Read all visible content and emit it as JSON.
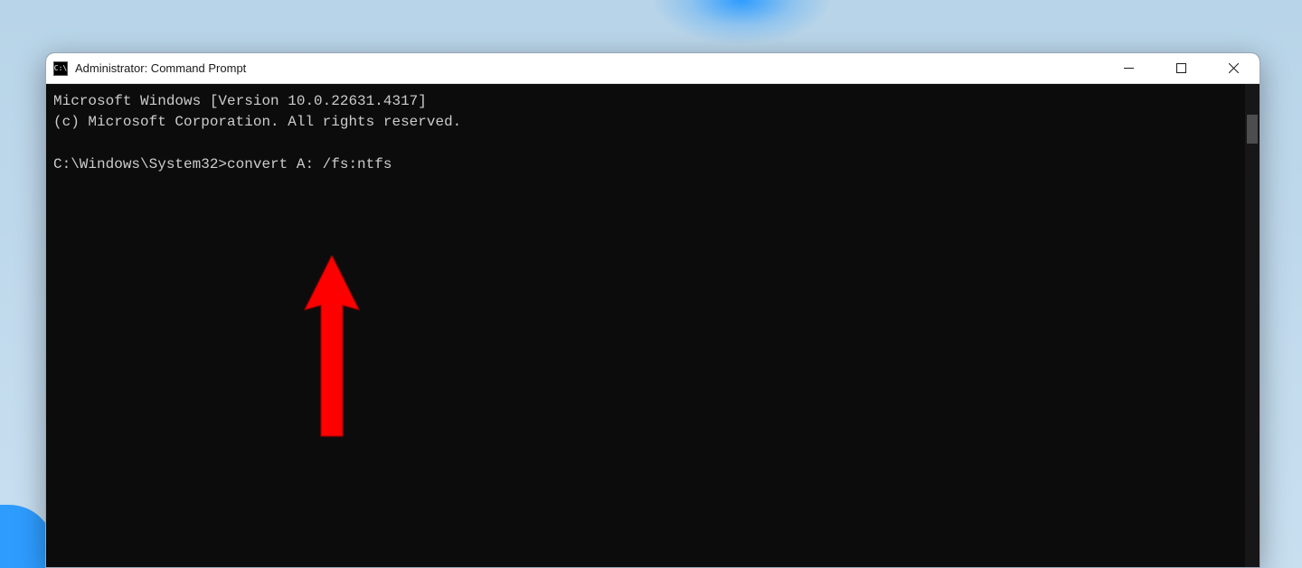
{
  "window": {
    "title": "Administrator: Command Prompt",
    "icon_label": "C:\\"
  },
  "terminal": {
    "line1": "Microsoft Windows [Version 10.0.22631.4317]",
    "line2": "(c) Microsoft Corporation. All rights reserved.",
    "blank": "",
    "prompt": "C:\\Windows\\System32>",
    "command": "convert A: /fs:ntfs"
  },
  "annotation": {
    "arrow_color": "#ff0000"
  }
}
